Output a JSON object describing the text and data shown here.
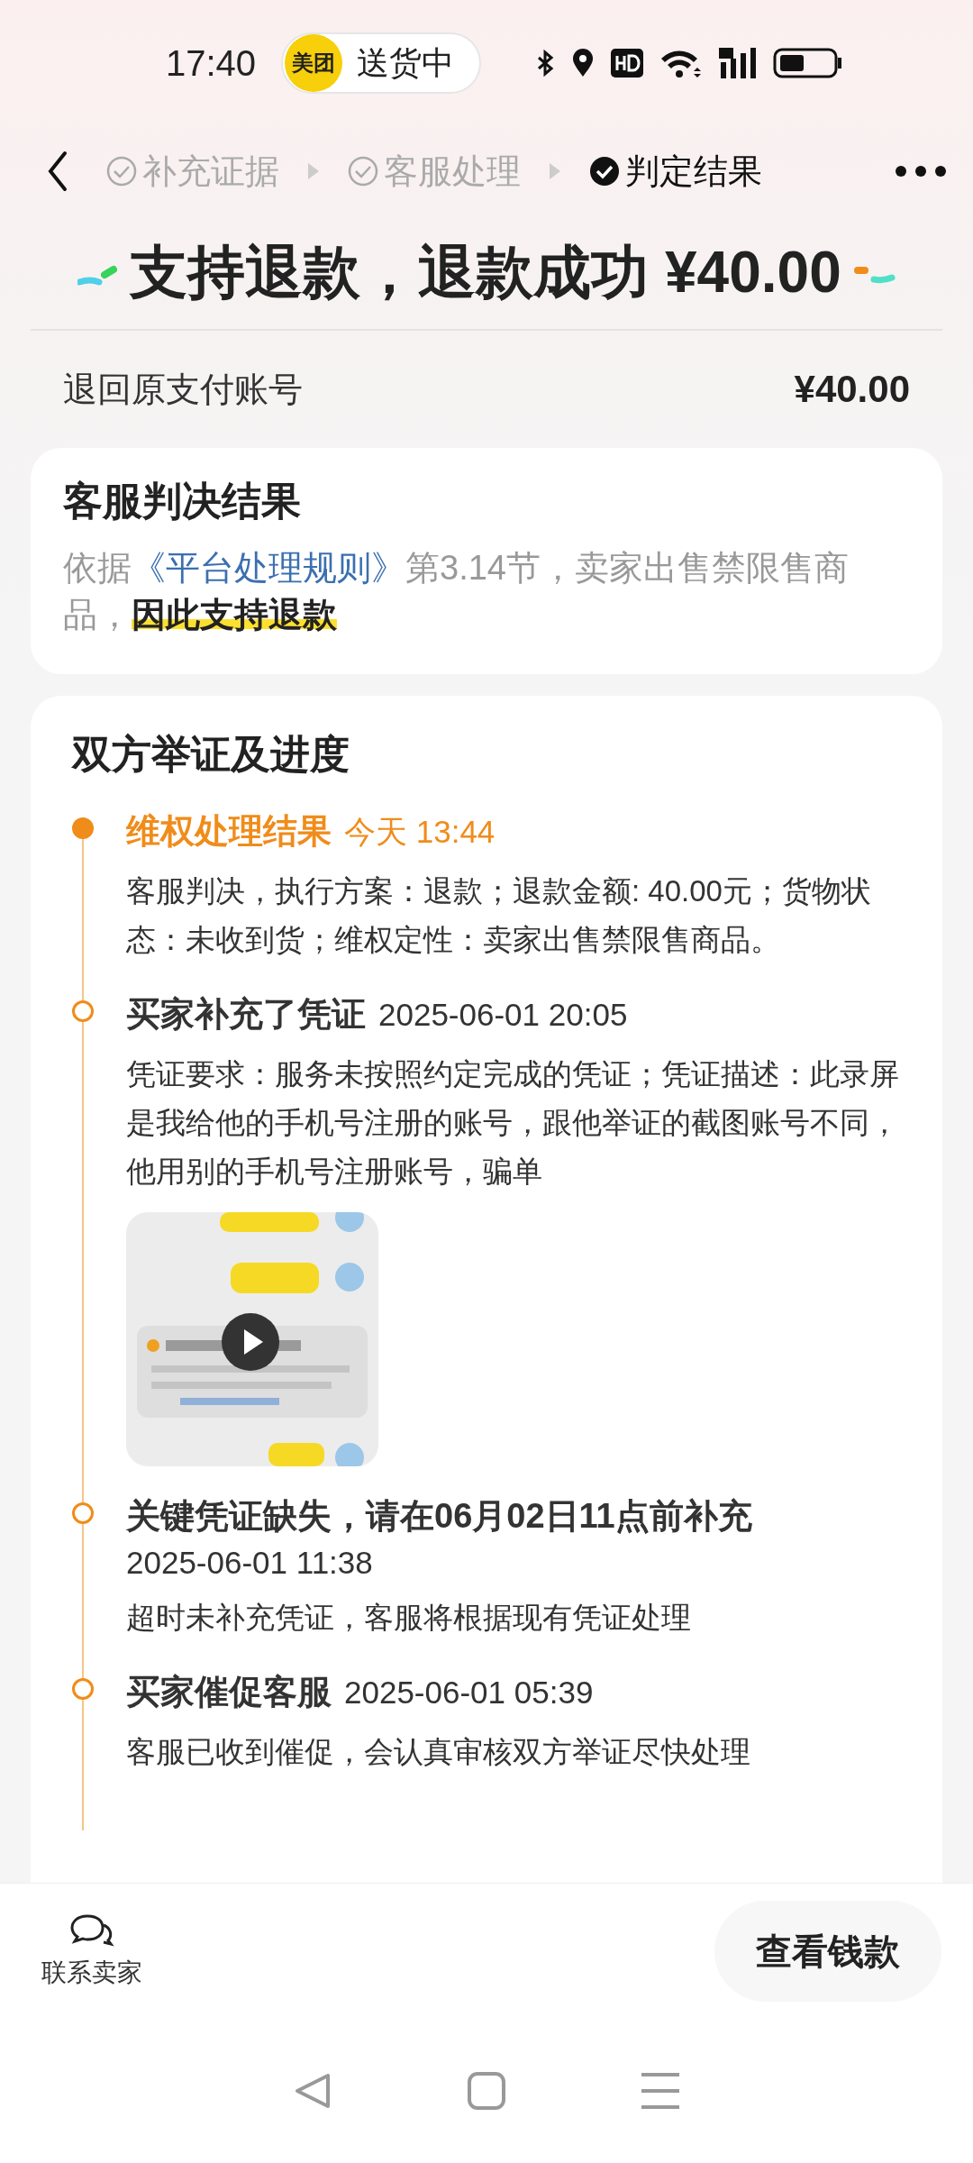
{
  "status_bar": {
    "time": "17:40",
    "app_badge": "美团",
    "activity": "送货中"
  },
  "steps": [
    {
      "label": "补充证据",
      "selected": false
    },
    {
      "label": "客服处理",
      "selected": false
    },
    {
      "label": "判定结果",
      "selected": true
    }
  ],
  "headline": "支持退款，退款成功 ¥40.00",
  "refund_row": {
    "label": "退回原支付账号",
    "amount": "¥40.00"
  },
  "verdict_card": {
    "title": "客服判决结果",
    "text_before": "依据",
    "link": "《平台处理规则》",
    "text_after": "第3.14节，卖家出售禁限售商品，",
    "highlight": "因此支持退款"
  },
  "progress_card": {
    "title": "双方举证及进度",
    "events": [
      {
        "title": "维权处理结果",
        "time": "今天 13:44",
        "body": "客服判决，执行方案：退款；退款金额: 40.00元；货物状态：未收到货；维权定性：卖家出售禁限售商品。",
        "active": true
      },
      {
        "title": "买家补充了凭证",
        "time": "2025-06-01 20:05",
        "body": "凭证要求：服务未按照约定完成的凭证；凭证描述：此录屏是我给他的手机号注册的账号，跟他举证的截图账号不同，他用别的手机号注册账号，骗单",
        "active": false,
        "attachment": {
          "kind": "video"
        }
      },
      {
        "title": "关键凭证缺失，请在06月02日11点前补充",
        "time": "2025-06-01 11:38",
        "body": "超时未补充凭证，客服将根据现有凭证处理",
        "active": false
      },
      {
        "title": "买家催促客服",
        "time": "2025-06-01 05:39",
        "body": "客服已收到催促，会认真审核双方举证尽快处理",
        "active": false
      }
    ]
  },
  "bottom_bar": {
    "contact": "联系卖家",
    "button": "查看钱款"
  }
}
